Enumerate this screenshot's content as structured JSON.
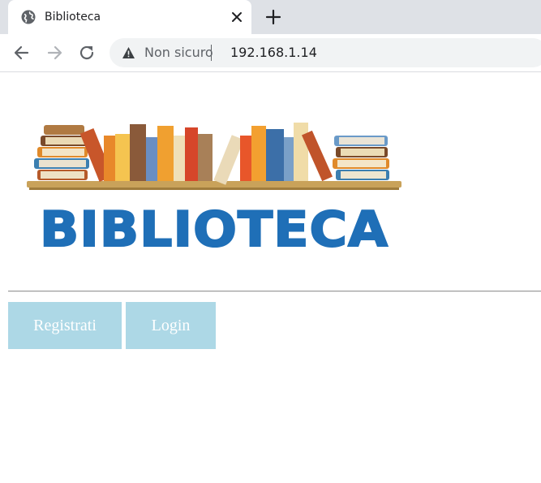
{
  "browser": {
    "tab": {
      "title": "Biblioteca",
      "favicon": "globe-icon"
    },
    "toolbar": {
      "security_label": "Non sicuro",
      "url": "192.168.1.14"
    }
  },
  "page": {
    "logo_text": "BIBLIOTECA",
    "buttons": {
      "register": "Registrati",
      "login": "Login"
    }
  },
  "colors": {
    "button_bg": "#add8e6",
    "button_text": "#ffffff",
    "logo_blue": "#1f6fb7"
  }
}
